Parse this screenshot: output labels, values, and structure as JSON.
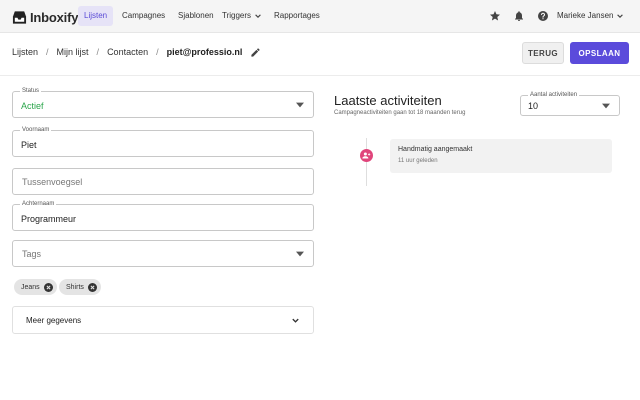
{
  "app": {
    "logo_text": "Inboxify"
  },
  "nav": {
    "items": [
      {
        "label": "Lijsten",
        "active": true
      },
      {
        "label": "Campagnes"
      },
      {
        "label": "Sjablonen"
      },
      {
        "label": "Triggers"
      },
      {
        "label": "Rapportages"
      }
    ],
    "user_name": "Marieke Jansen",
    "icons": [
      "star-icon",
      "bell-icon",
      "help-icon",
      "chevron-down-icon"
    ]
  },
  "breadcrumb": [
    "Lijsten",
    "Mijn lijst",
    "Contacten",
    "piet@professio.nl"
  ],
  "buttons": {
    "back_label": "TERUG",
    "save_label": "OPSLAAN"
  },
  "form": {
    "status": {
      "label": "Status",
      "value": "Actief"
    },
    "voornaam": {
      "label": "Voornaam",
      "value": "Piet"
    },
    "tussenvoegsel": {
      "placeholder": "Tussenvoegsel"
    },
    "achternaam": {
      "label": "Achternaam",
      "value": "Programmeur"
    },
    "tags": {
      "placeholder": "Tags",
      "chips": [
        "Jeans",
        "Shirts"
      ]
    },
    "meer_label": "Meer gegevens"
  },
  "activity": {
    "title": "Laatste activiteiten",
    "subtitle": "Campagneactiviteiten gaan tot 18 maanden terug",
    "count_label": "Aantal activiteiten",
    "count_value": "10",
    "items": [
      {
        "title": "Handmatig aangemaakt",
        "time": "11 uur geleden"
      }
    ]
  },
  "colors": {
    "accent": "#5b4bdb",
    "status_active": "#2aa54a",
    "timeline_dot": "#e0457b"
  }
}
